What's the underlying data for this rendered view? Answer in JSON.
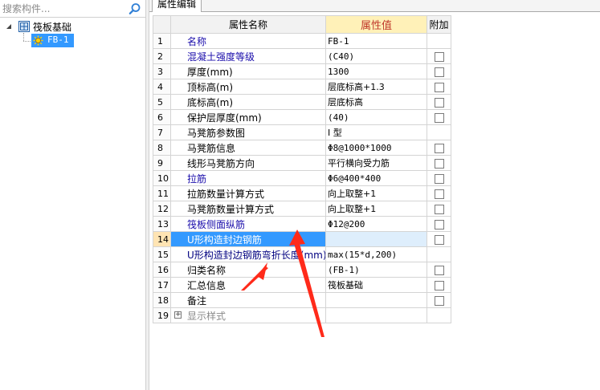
{
  "search": {
    "placeholder": "搜索构件..."
  },
  "tree": {
    "root_label": "筏板基础",
    "child_label": "FB-1"
  },
  "tab": {
    "label": "属性编辑"
  },
  "grid": {
    "headers": {
      "name": "属性名称",
      "value": "属性值",
      "extra": "附加"
    },
    "rows": [
      {
        "num": "1",
        "name": "名称",
        "value": "FB-1"
      },
      {
        "num": "2",
        "name": "混凝土强度等级",
        "value": "(C40)"
      },
      {
        "num": "3",
        "name": "厚度(mm)",
        "value": "1300"
      },
      {
        "num": "4",
        "name": "顶标高(m)",
        "value": "层底标高+1.3"
      },
      {
        "num": "5",
        "name": "底标高(m)",
        "value": "层底标高"
      },
      {
        "num": "6",
        "name": "保护层厚度(mm)",
        "value": "(40)"
      },
      {
        "num": "7",
        "name": "马凳筋参数图",
        "value": "I 型"
      },
      {
        "num": "8",
        "name": "马凳筋信息",
        "value": "Φ8@1000*1000"
      },
      {
        "num": "9",
        "name": "线形马凳筋方向",
        "value": "平行横向受力筋"
      },
      {
        "num": "10",
        "name": "拉筋",
        "value": "Φ6@400*400"
      },
      {
        "num": "11",
        "name": "拉筋数量计算方式",
        "value": "向上取整+1"
      },
      {
        "num": "12",
        "name": "马凳筋数量计算方式",
        "value": "向上取整+1"
      },
      {
        "num": "13",
        "name": "筏板侧面纵筋",
        "value": "Φ12@200"
      },
      {
        "num": "14",
        "name": "U形构造封边钢筋",
        "value": ""
      },
      {
        "num": "15",
        "name": "U形构造封边钢筋弯折长度(mm)",
        "value": "max(15*d,200)"
      },
      {
        "num": "16",
        "name": "归类名称",
        "value": "(FB-1)"
      },
      {
        "num": "17",
        "name": "汇总信息",
        "value": "筏板基础"
      },
      {
        "num": "18",
        "name": "备注",
        "value": ""
      },
      {
        "num": "19",
        "name": "显示样式",
        "value": ""
      }
    ]
  },
  "colors": {
    "selected_row": "#3399ff",
    "value_header_bg": "#fff1b8",
    "value_header_text": "#c0392b",
    "arrow": "#ff2a1a",
    "blue_label": "#1a0dab"
  },
  "icons": {
    "search": "magnifier-icon",
    "tree_toggle": "triangle-expanded-icon",
    "root": "foundation-grid-icon",
    "child": "sun-gear-icon",
    "expand": "plus-box-icon"
  }
}
